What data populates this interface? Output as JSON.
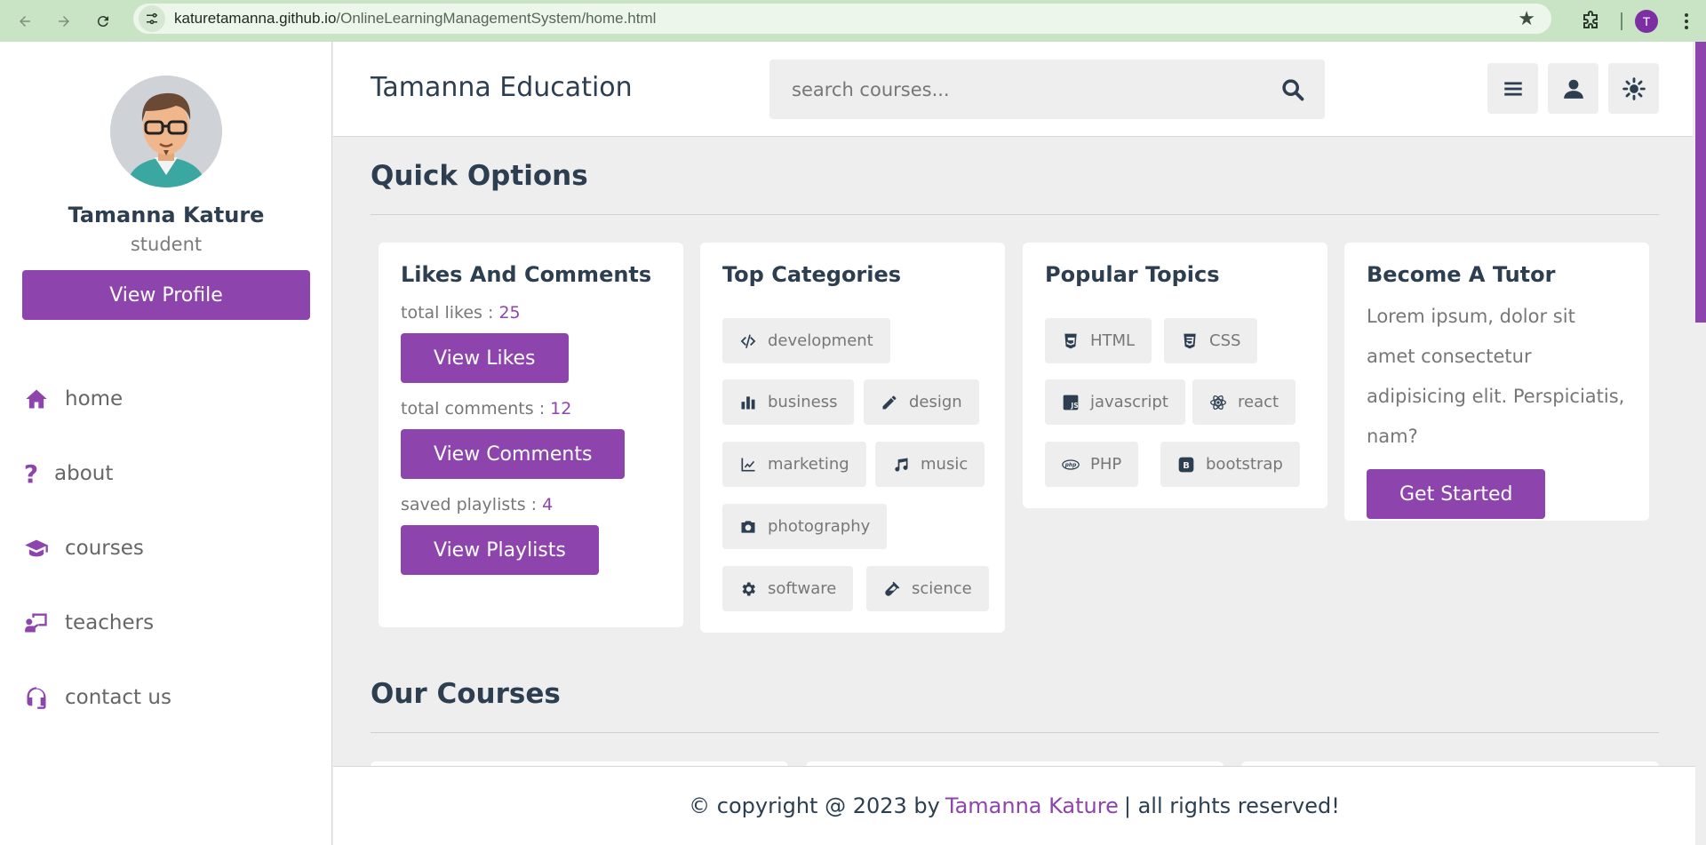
{
  "browser": {
    "url_host": "katuretamanna.github.io",
    "url_path": "/OnlineLearningManagementSystem/home.html",
    "profile_initial": "T"
  },
  "sidebar": {
    "name": "Tamanna Kature",
    "role": "student",
    "view_profile": "View Profile",
    "items": [
      {
        "label": "home",
        "icon": "home-icon"
      },
      {
        "label": "about",
        "icon": "question-icon"
      },
      {
        "label": "courses",
        "icon": "graduation-cap-icon"
      },
      {
        "label": "teachers",
        "icon": "chalkboard-teacher-icon"
      },
      {
        "label": "contact us",
        "icon": "headset-icon"
      }
    ]
  },
  "header": {
    "brand": "Tamanna Education",
    "search_placeholder": "search courses..."
  },
  "quick_options": {
    "title": "Quick Options",
    "likes_card": {
      "title": "Likes And Comments",
      "likes_label": "total likes : ",
      "likes_value": "25",
      "likes_button": "View Likes",
      "comments_label": "total comments : ",
      "comments_value": "12",
      "comments_button": "View Comments",
      "playlists_label": "saved playlists : ",
      "playlists_value": "4",
      "playlists_button": "View Playlists"
    },
    "categories_card": {
      "title": "Top Categories",
      "tags": [
        "development",
        "business",
        "design",
        "marketing",
        "music",
        "photography",
        "software",
        "science"
      ]
    },
    "topics_card": {
      "title": "Popular Topics",
      "tags": [
        "HTML",
        "CSS",
        "javascript",
        "react",
        "PHP",
        "bootstrap"
      ]
    },
    "tutor_card": {
      "title": "Become A Tutor",
      "text": "Lorem ipsum, dolor sit amet consectetur adipisicing elit. Perspiciatis, nam?",
      "button": "Get Started"
    }
  },
  "courses": {
    "title": "Our Courses"
  },
  "footer": {
    "prefix": "© copyright @ 2023 by",
    "author": "Tamanna Kature",
    "suffix": "| all rights reserved!"
  },
  "colors": {
    "accent": "#8e44ad",
    "text": "#2c3e50",
    "background": "#eeeeee",
    "chrome": "#c9e4c5"
  }
}
